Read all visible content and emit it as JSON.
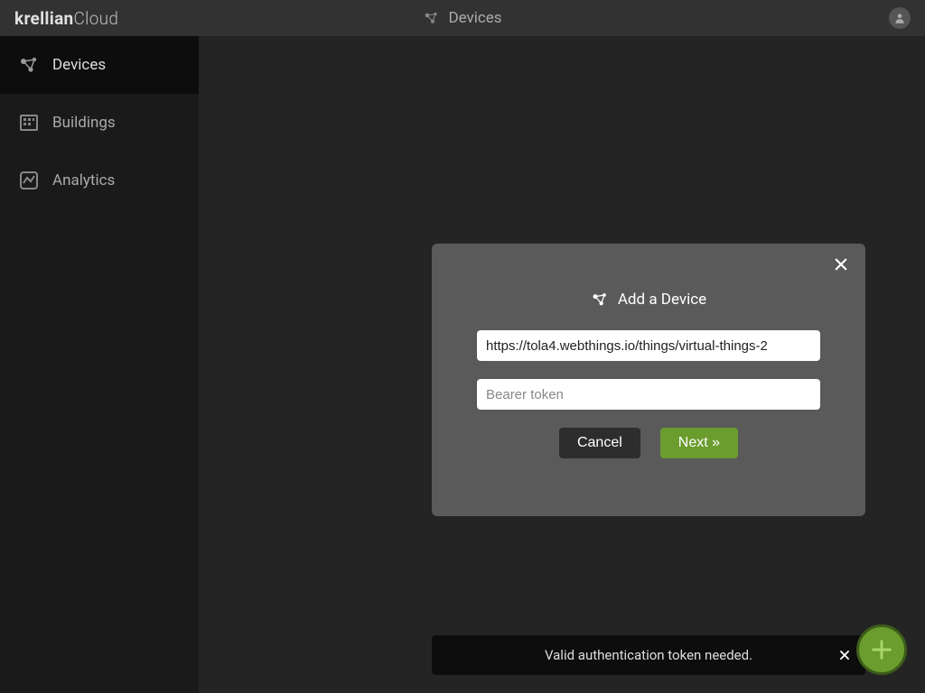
{
  "brand": {
    "bold": "krellian",
    "light": "Cloud"
  },
  "topbar": {
    "title": "Devices"
  },
  "sidebar": {
    "items": [
      {
        "label": "Devices"
      },
      {
        "label": "Buildings"
      },
      {
        "label": "Analytics"
      }
    ]
  },
  "modal": {
    "title": "Add a Device",
    "url_value": "https://tola4.webthings.io/things/virtual-things-2",
    "token_placeholder": "Bearer token",
    "cancel_label": "Cancel",
    "next_label": "Next »"
  },
  "toast": {
    "message": "Valid authentication token needed."
  },
  "colors": {
    "accent": "#6b9c2e",
    "bg": "#242424",
    "sidebar": "#1a1a1a",
    "modal": "#5a5a5a"
  }
}
